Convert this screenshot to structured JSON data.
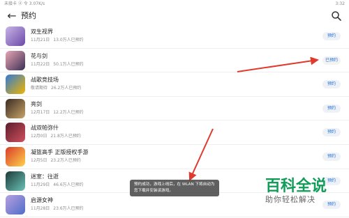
{
  "status_bar": {
    "left": "未接卡 ⓓ 令 3.07K/s",
    "right": "3:32"
  },
  "header": {
    "title": "预约"
  },
  "items": [
    {
      "name": "双生视界",
      "date": "11月21日",
      "stat": "13.0万人已预约",
      "button": "预约",
      "reserved": false,
      "icon_colors": [
        "#c8b4e6",
        "#6a4aa8"
      ]
    },
    {
      "name": "花与剑",
      "date": "11月22日",
      "stat": "50.1万人已预约",
      "button": "已预约",
      "reserved": true,
      "icon_colors": [
        "#e8a6b4",
        "#3b2f55"
      ]
    },
    {
      "name": "战歌竞技场",
      "date": "敬请期待",
      "stat": "26.2万人已预约",
      "button": "预约",
      "reserved": false,
      "icon_colors": [
        "#2f7bd6",
        "#f0b400"
      ]
    },
    {
      "name": "亮剑",
      "date": "12月17日",
      "stat": "12.2万人已预约",
      "button": "预约",
      "reserved": false,
      "icon_colors": [
        "#3a2a22",
        "#c9a56a"
      ]
    },
    {
      "name": "战双帕弥什",
      "date": "12月0日",
      "stat": "21.8万人已预约",
      "button": "预约",
      "reserved": false,
      "icon_colors": [
        "#5a1e2c",
        "#d04f5e"
      ]
    },
    {
      "name": "凝篮高手 正版授权手游",
      "date": "12月5日",
      "stat": "23.2万人已预约",
      "button": "预约",
      "reserved": false,
      "icon_colors": [
        "#d83b2a",
        "#ffd24a"
      ]
    },
    {
      "name": "迷室：往逝",
      "date": "11月29日",
      "stat": "46.6万人已预约",
      "button": "预约",
      "reserved": false,
      "icon_colors": [
        "#1e3a3a",
        "#6ac2b6"
      ]
    },
    {
      "name": "启源女神",
      "date": "11月28日",
      "stat": "23.6万人已预约",
      "button": "预约",
      "reserved": false,
      "icon_colors": [
        "#b8a0e0",
        "#4f6cc8"
      ]
    }
  ],
  "toast": {
    "text": "预约成功，游戏上线后，在 WLAN 下将自动为您下载并安装该游戏。"
  },
  "watermark": {
    "title": "百科全说",
    "subtitle": "助你轻松解决"
  },
  "colors": {
    "accent": "#1b6fd9",
    "arrow": "#e03a2f",
    "watermark": "#0f9d58"
  }
}
